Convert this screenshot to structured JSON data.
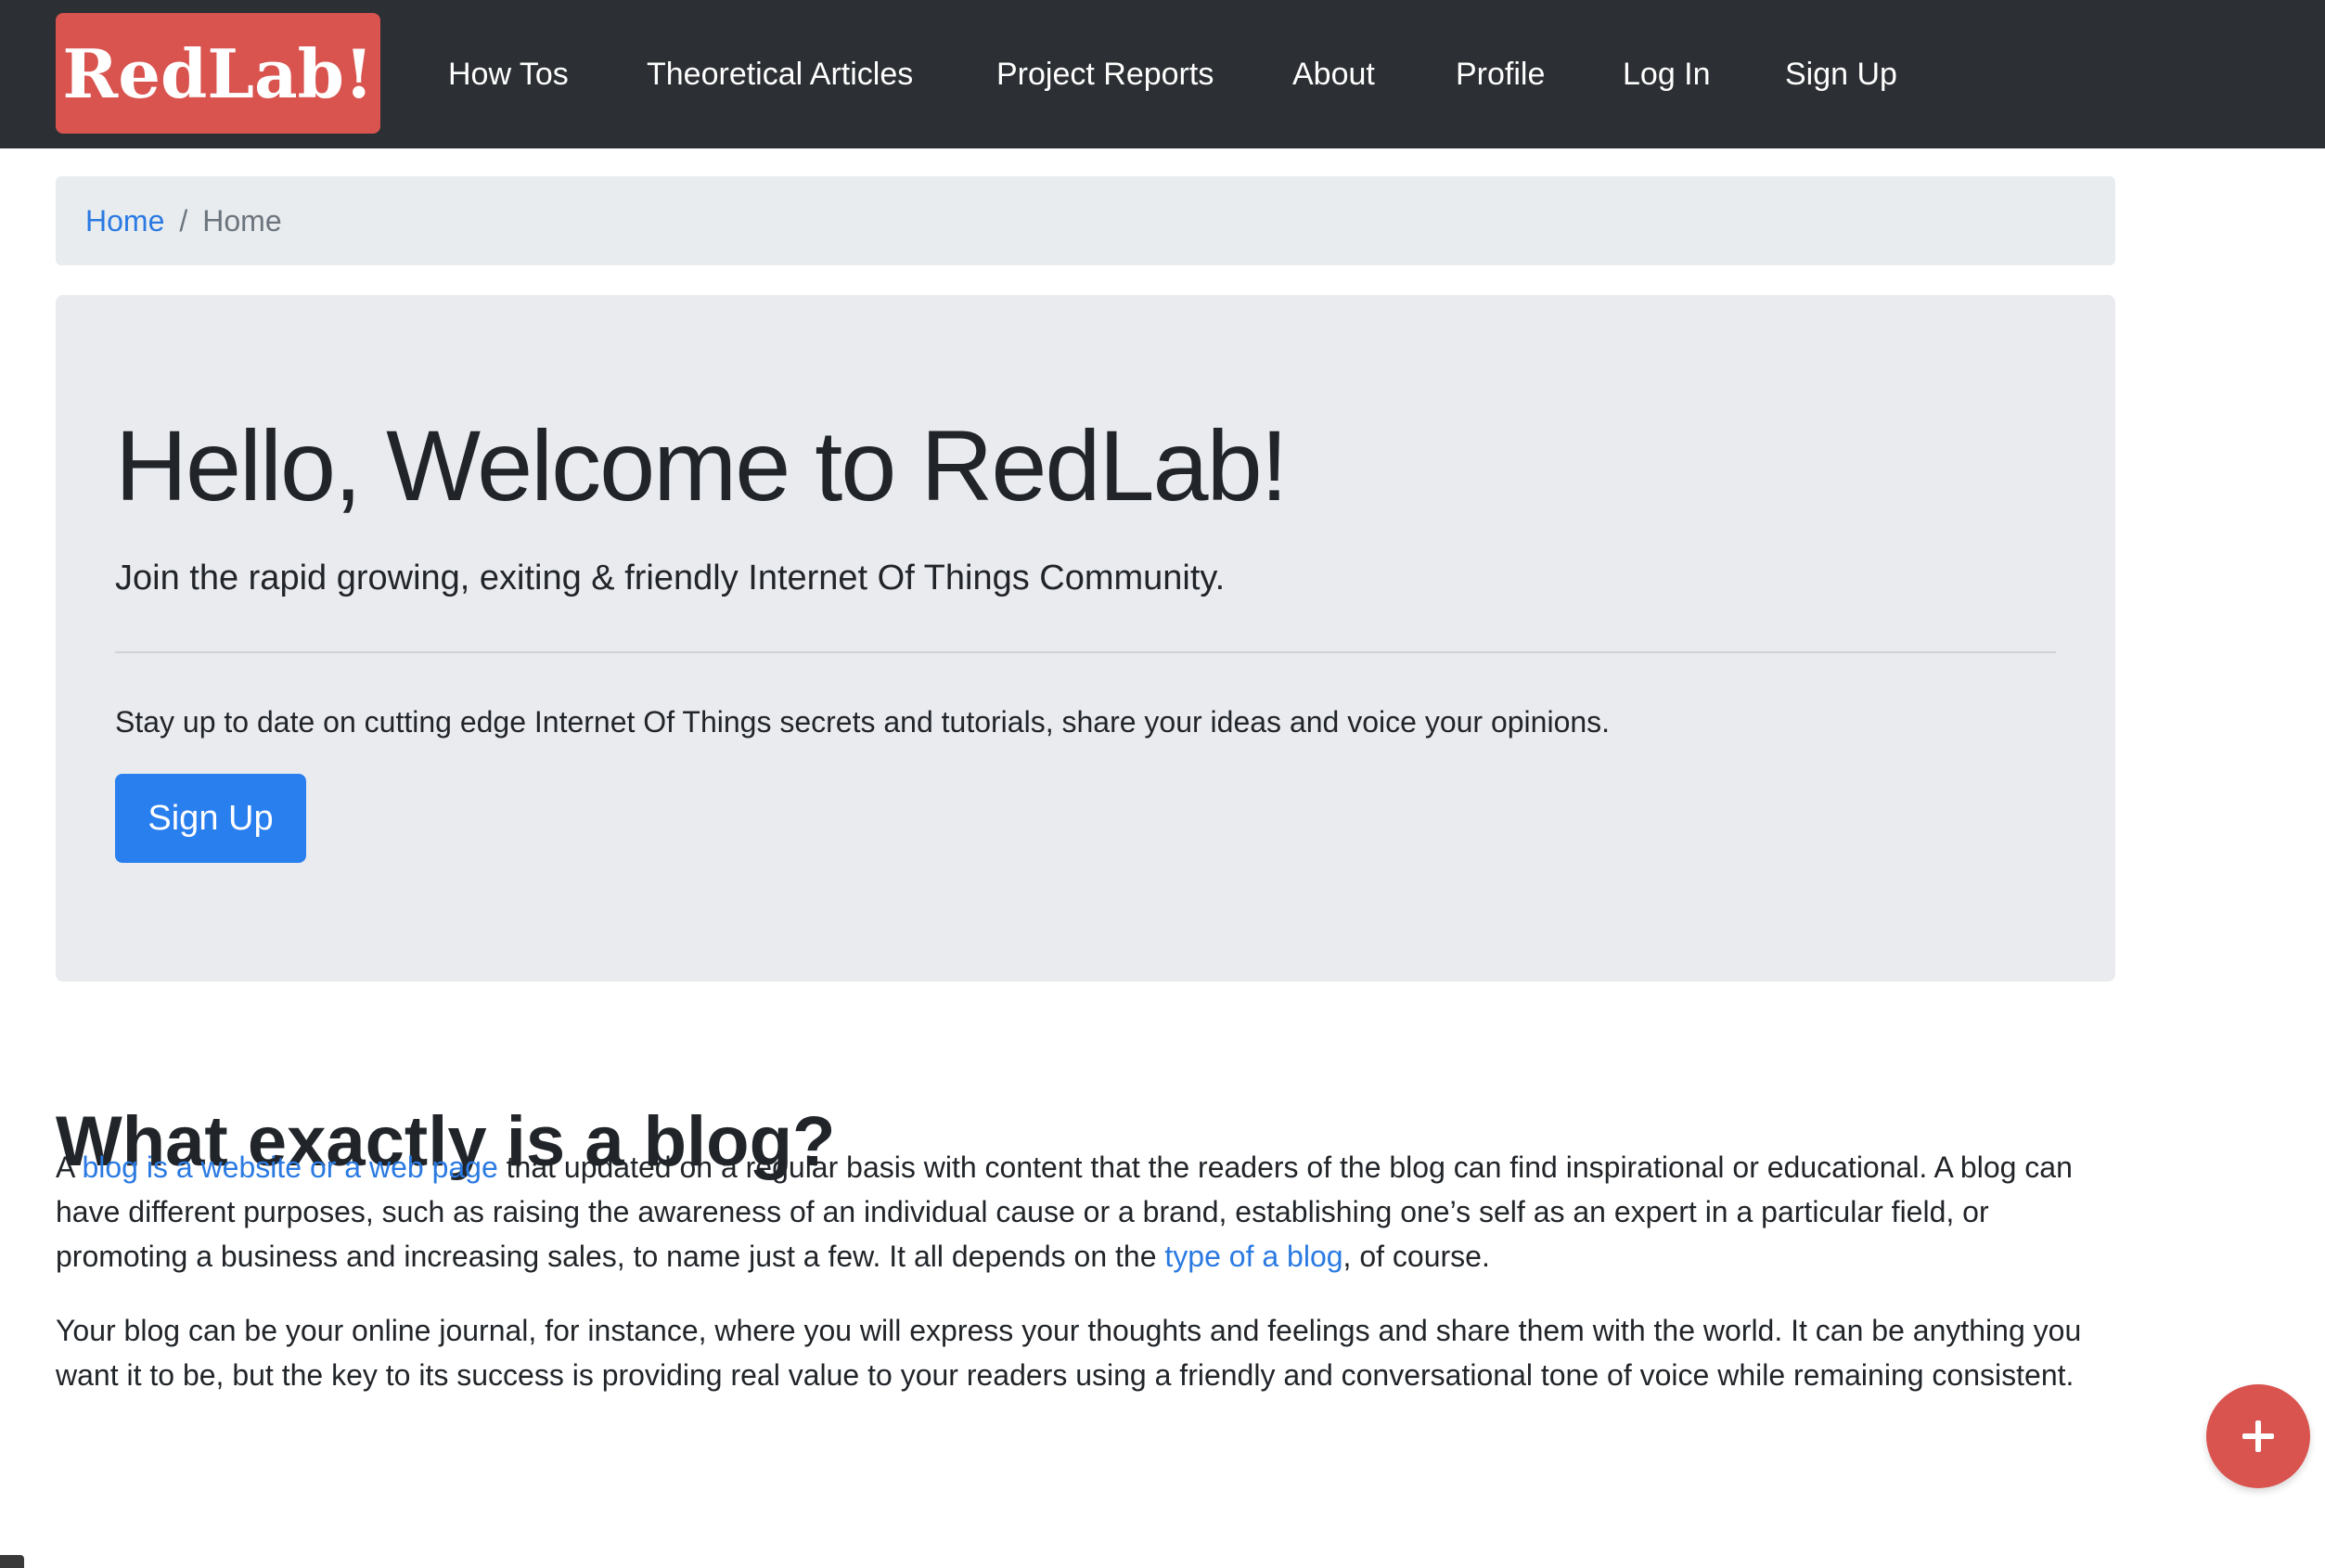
{
  "navbar": {
    "brand": "RedLab!",
    "links": [
      {
        "label": "How Tos"
      },
      {
        "label": "Theoretical Articles"
      },
      {
        "label": "Project Reports"
      },
      {
        "label": "About"
      },
      {
        "label": "Profile"
      },
      {
        "label": "Log In"
      },
      {
        "label": "Sign Up"
      }
    ]
  },
  "breadcrumb": {
    "home": "Home",
    "separator": "/",
    "active": "Home"
  },
  "jumbotron": {
    "title": "Hello, Welcome to RedLab!",
    "lead": "Join the rapid growing, exiting & friendly Internet Of Things Community.",
    "text": "Stay up to date on cutting edge Internet Of Things secrets and tutorials, share your ideas and voice your opinions.",
    "button": "Sign Up"
  },
  "article": {
    "heading": "What exactly is a blog?",
    "para1": {
      "t1": "A ",
      "link1": "blog is a website or a web page",
      "t2": " that updated on a regular basis with content that the readers of the blog can find inspirational or educational. A blog can have different purposes, such as raising the awareness of an individual cause or a brand, establishing one’s self as an expert in a particular field, or promoting a business and increasing sales, to name just a few. It all depends on the ",
      "link2": "type of a blog",
      "t3": ", of course."
    },
    "para2": "Your blog can be your online journal, for instance, where you will express your thoughts and feelings and share them with the world. It can be anything you want it to be, but the key to its success is providing real value to your readers using a friendly and conversational tone of voice while remaining consistent."
  },
  "fab": {
    "icon": "plus-icon"
  },
  "colors": {
    "navbar_bg": "#2c2f33",
    "brand_bg": "#d9534f",
    "link": "#2a7ae2",
    "primary_button": "#2a7fef",
    "panel_bg": "#e9ecef"
  }
}
